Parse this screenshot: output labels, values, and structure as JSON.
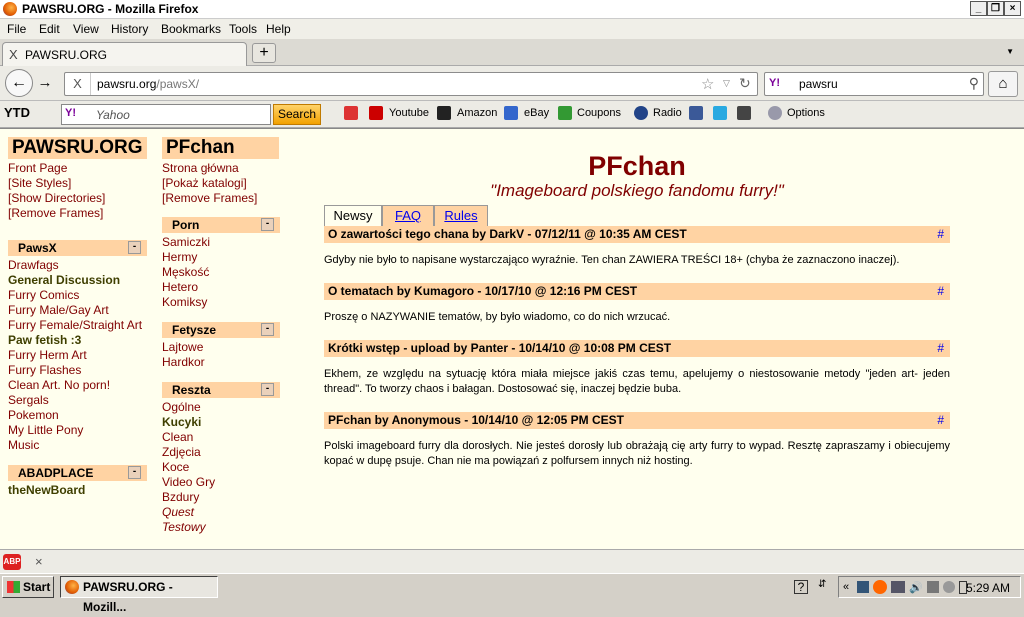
{
  "window": {
    "title": "PAWSRU.ORG - Mozilla Firefox"
  },
  "menu": [
    "File",
    "Edit",
    "View",
    "History",
    "Bookmarks",
    "Tools",
    "Help"
  ],
  "tab": {
    "title": "PAWSRU.ORG",
    "close": "X"
  },
  "address": {
    "domain": "pawsru.org",
    "path": "/pawsX/",
    "site_icon": "X"
  },
  "search": {
    "value": "pawsru",
    "engine": "Y!"
  },
  "toolbar": {
    "ytd": "YTD",
    "yahoo_engine": "Y!",
    "yahoo_placeholder": "Yahoo",
    "search_btn": "Search",
    "links": [
      "Youtube",
      "Amazon",
      "eBay",
      "Coupons",
      "Radio"
    ],
    "options": "Options"
  },
  "left": {
    "title": "PAWSRU.ORG",
    "links": [
      "Front Page",
      "[Site Styles]",
      "[Show Directories]",
      "[Remove Frames]"
    ],
    "pawsx": {
      "header": "PawsX",
      "items": [
        {
          "label": "Drawfags",
          "bold": false
        },
        {
          "label": "General Discussion",
          "bold": true
        },
        {
          "label": "Furry Comics",
          "bold": false
        },
        {
          "label": "Furry Male/Gay Art",
          "bold": false
        },
        {
          "label": "Furry Female/Straight Art",
          "bold": false
        },
        {
          "label": "Paw fetish :3",
          "bold": true
        },
        {
          "label": "Furry Herm Art",
          "bold": false
        },
        {
          "label": "Furry Flashes",
          "bold": false
        },
        {
          "label": "Clean Art. No porn!",
          "bold": false
        },
        {
          "label": "Sergals",
          "bold": false
        },
        {
          "label": "Pokemon",
          "bold": false
        },
        {
          "label": "My Little Pony",
          "bold": false
        },
        {
          "label": "Music",
          "bold": false
        }
      ]
    },
    "abadplace": {
      "header": "ABADPLACE",
      "items": [
        "theNewBoard"
      ]
    },
    "toggle": "-"
  },
  "pf": {
    "title": "PFchan",
    "links": [
      "Strona główna",
      "[Pokaż katalogi]",
      "[Remove Frames]"
    ],
    "porn": {
      "header": "Porn",
      "items": [
        "Samiczki",
        "Hermy",
        "Męskość",
        "Hetero",
        "Komiksy"
      ]
    },
    "fetysze": {
      "header": "Fetysze",
      "items": [
        "Lajtowe",
        "Hardkor"
      ]
    },
    "reszta": {
      "header": "Reszta",
      "items": [
        {
          "label": "Ogólne",
          "style": ""
        },
        {
          "label": "Kucyki",
          "style": "bold"
        },
        {
          "label": "Clean",
          "style": ""
        },
        {
          "label": "Zdjęcia",
          "style": ""
        },
        {
          "label": "Koce",
          "style": ""
        },
        {
          "label": "Video Gry",
          "style": ""
        },
        {
          "label": "Bzdury",
          "style": ""
        },
        {
          "label": "Quest",
          "style": "ital"
        },
        {
          "label": "Testowy",
          "style": "ital"
        }
      ]
    }
  },
  "main": {
    "title": "PFchan",
    "subtitle": "\"Imageboard polskiego fandomu furry!\"",
    "tabs": [
      "Newsy",
      "FAQ",
      "Rules"
    ],
    "news": [
      {
        "title": "O zawartości tego chana by DarkV - 07/12/11 @ 10:35 AM CEST",
        "body": "Gdyby nie było to napisane wystarczająco wyraźnie. Ten chan ZAWIERA TREŚCI 18+ (chyba że zaznaczono inaczej)."
      },
      {
        "title": "O tematach by Kumagoro - 10/17/10 @ 12:16 PM CEST",
        "body": "Proszę o NAZYWANIE tematów, by było wiadomo, co do nich wrzucać."
      },
      {
        "title": "Krótki wstęp - upload by Panter - 10/14/10 @ 10:08 PM CEST",
        "body": "Ekhem, ze względu na sytuację która miała miejsce jakiś czas temu, apelujemy o niestosowanie metody \"jeden art- jeden thread\". To tworzy chaos i bałagan. Dostosować się, inaczej będzie buba."
      },
      {
        "title": "PFchan by Anonymous - 10/14/10 @ 12:05 PM CEST",
        "body": "Polski imageboard furry dla dorosłych. Nie jesteś dorosły lub obrażają cię arty furry to wypad. Resztę zapraszamy i obiecujemy kopać w dupę psuje. Chan nie ma powiązań z polfursem innych niż hosting."
      }
    ],
    "hash": "#"
  },
  "taskbar": {
    "start": "Start",
    "item": "PAWSRU.ORG - Mozill...",
    "clock": "5:29 AM"
  },
  "addon": {
    "abp": "ABP",
    "close": "×"
  }
}
